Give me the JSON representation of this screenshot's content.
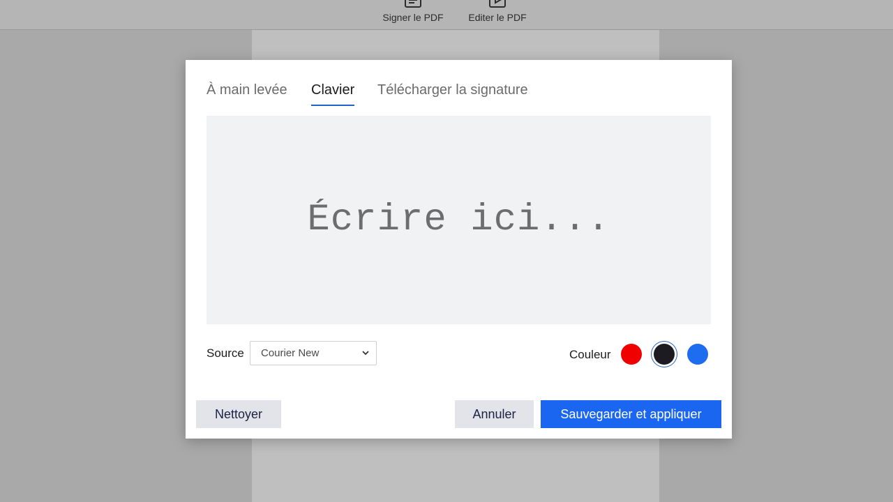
{
  "toolbar": {
    "sign_label": "Signer le PDF",
    "edit_label": "Editer le PDF"
  },
  "dialog": {
    "tabs": [
      {
        "label": "À main levée",
        "active": false
      },
      {
        "label": "Clavier",
        "active": true
      },
      {
        "label": "Télécharger la signature",
        "active": false
      }
    ],
    "input_placeholder": "Écrire ici...",
    "input_value": "",
    "source_label": "Source",
    "source_value": "Courier New",
    "color_label": "Couleur",
    "colors": {
      "red": "#f00000",
      "black": "#1c1b21",
      "blue": "#1e6df0",
      "selected": "black"
    },
    "buttons": {
      "clear": "Nettoyer",
      "cancel": "Annuler",
      "save": "Sauvegarder et appliquer"
    }
  }
}
